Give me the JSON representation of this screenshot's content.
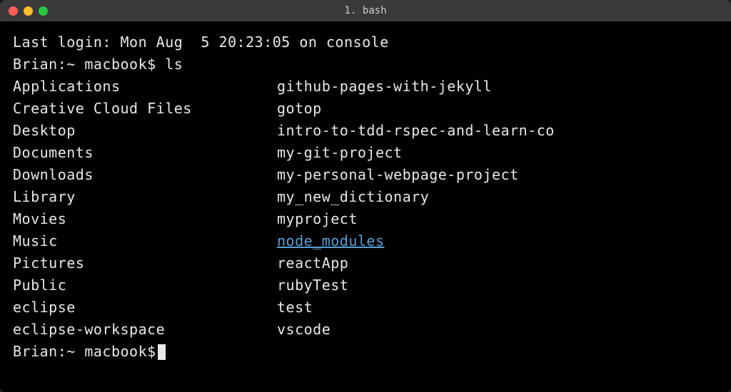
{
  "titlebar": {
    "title": "1. bash"
  },
  "terminal": {
    "last_login": "Last login: Mon Aug  5 20:23:05 on console",
    "prompt1": "Brian:~ macbook$ ",
    "command1": "ls",
    "prompt2": "Brian:~ macbook$ ",
    "ls_col1": {
      "i0": "Applications",
      "i1": "Creative Cloud Files",
      "i2": "Desktop",
      "i3": "Documents",
      "i4": "Downloads",
      "i5": "Library",
      "i6": "Movies",
      "i7": "Music",
      "i8": "Pictures",
      "i9": "Public",
      "i10": "eclipse",
      "i11": "eclipse-workspace"
    },
    "ls_col2": {
      "i0": "github-pages-with-jekyll",
      "i1": "gotop",
      "i2": "intro-to-tdd-rspec-and-learn-co",
      "i3": "my-git-project",
      "i4": "my-personal-webpage-project",
      "i5": "my_new_dictionary",
      "i6": "myproject",
      "i7": "node_modules",
      "i8": "reactApp",
      "i9": "rubyTest",
      "i10": "test",
      "i11": "vscode"
    }
  }
}
